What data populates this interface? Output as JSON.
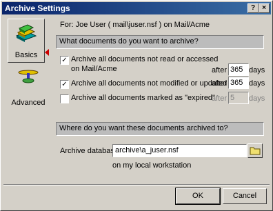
{
  "window": {
    "title": "Archive Settings",
    "help_label": "?",
    "close_label": "×"
  },
  "sidebar": {
    "items": [
      {
        "label": "Basics",
        "icon": "books-icon",
        "selected": true
      },
      {
        "label": "Advanced",
        "icon": "propeller-icon",
        "selected": false
      }
    ]
  },
  "header": {
    "user_line": "For: Joe User ( mail\\juser.nsf ) on Mail/Acme"
  },
  "section1": {
    "title": "What documents do you want to archive?"
  },
  "options": [
    {
      "line1": "Archive all documents not read or accessed",
      "line2": "on Mail/Acme",
      "checked": true,
      "after_label": "after",
      "days": "365",
      "days_label": "days",
      "enabled": true
    },
    {
      "line1": "Archive all documents not modified or updated",
      "checked": true,
      "after_label": "after",
      "days": "365",
      "days_label": "days",
      "enabled": true
    },
    {
      "line1": "Archive all documents marked as \"expired\"",
      "checked": false,
      "after_label": "after",
      "days": "5",
      "days_label": "days",
      "enabled": false
    }
  ],
  "section2": {
    "title": "Where do you want these documents archived to?"
  },
  "archive": {
    "label": "Archive database",
    "value": "archive\\a_juser.nsf",
    "location": "on my local workstation"
  },
  "buttons": {
    "ok": "OK",
    "cancel": "Cancel"
  },
  "colors": {
    "titlebar": "#0a246a",
    "selection_arrow": "#cc0000",
    "dialog": "#d4d0c8"
  }
}
